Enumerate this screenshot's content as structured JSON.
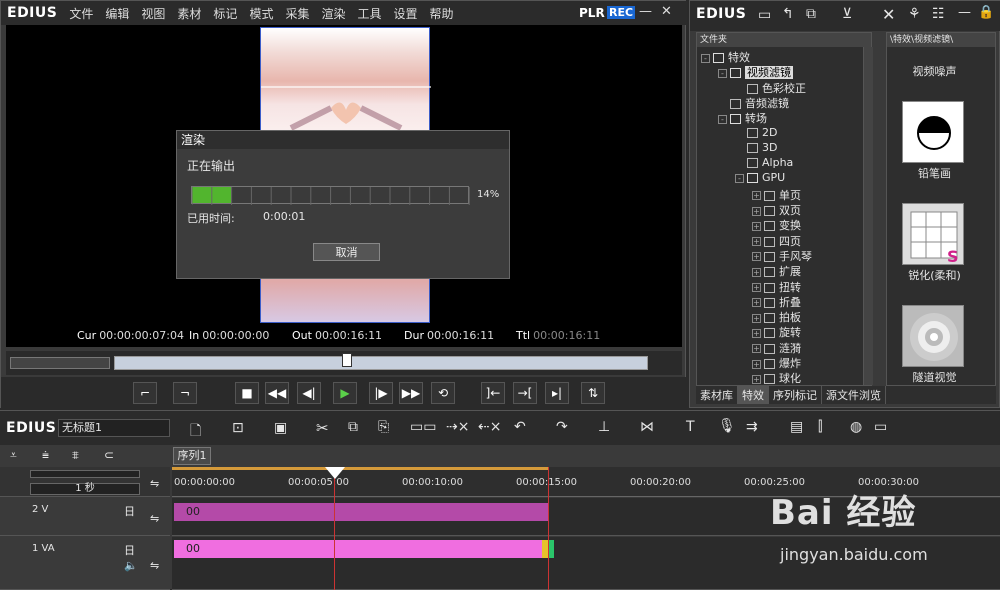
{
  "player": {
    "logo": "EDIUS",
    "menu": [
      "文件",
      "编辑",
      "视图",
      "素材",
      "标记",
      "模式",
      "采集",
      "渲染",
      "工具",
      "设置",
      "帮助"
    ],
    "plr": "PLR",
    "rec": "REC",
    "timecodes": [
      {
        "label": "Cur",
        "value": "00:00:00:07:04"
      },
      {
        "label": "In",
        "value": "00:00:00:00"
      },
      {
        "label": "Out",
        "value": "00:00:16:11"
      },
      {
        "label": "Dur",
        "value": "00:00:16:11"
      },
      {
        "label": "Ttl",
        "value": "00:00:16:11"
      }
    ]
  },
  "render_dialog": {
    "title": "渲染",
    "status": "正在输出",
    "progress": 14,
    "progress_label": "14%",
    "elapsed_label": "已用时间:",
    "elapsed_value": "0:00:01",
    "cancel": "取消"
  },
  "bin": {
    "logo": "EDIUS",
    "tree_header": "文件夹",
    "thumbs_header": "\\特效\\视频滤镜\\",
    "tree": [
      {
        "label": "特效",
        "level": 0,
        "exp": "-",
        "folder": true
      },
      {
        "label": "视频滤镜",
        "level": 1,
        "exp": "-",
        "folder": true,
        "selected": true
      },
      {
        "label": "色彩校正",
        "level": 2,
        "exp": "",
        "folder": false
      },
      {
        "label": "音频滤镜",
        "level": 1,
        "exp": "",
        "folder": false
      },
      {
        "label": "转场",
        "level": 1,
        "exp": "-",
        "folder": true
      },
      {
        "label": "2D",
        "level": 2,
        "exp": "",
        "folder": false
      },
      {
        "label": "3D",
        "level": 2,
        "exp": "",
        "folder": false
      },
      {
        "label": "Alpha",
        "level": 2,
        "exp": "",
        "folder": false
      },
      {
        "label": "GPU",
        "level": 2,
        "exp": "-",
        "folder": true
      },
      {
        "label": "单页",
        "level": 3,
        "exp": "+",
        "folder": false
      },
      {
        "label": "双页",
        "level": 3,
        "exp": "+",
        "folder": false
      },
      {
        "label": "变换",
        "level": 3,
        "exp": "+",
        "folder": false
      },
      {
        "label": "四页",
        "level": 3,
        "exp": "+",
        "folder": false
      },
      {
        "label": "手风琴",
        "level": 3,
        "exp": "+",
        "folder": false
      },
      {
        "label": "扩展",
        "level": 3,
        "exp": "+",
        "folder": false
      },
      {
        "label": "扭转",
        "level": 3,
        "exp": "+",
        "folder": false
      },
      {
        "label": "折叠",
        "level": 3,
        "exp": "+",
        "folder": false
      },
      {
        "label": "拍板",
        "level": 3,
        "exp": "+",
        "folder": false
      },
      {
        "label": "旋转",
        "level": 3,
        "exp": "+",
        "folder": false
      },
      {
        "label": "涟漪",
        "level": 3,
        "exp": "+",
        "folder": false
      },
      {
        "label": "爆炸",
        "level": 3,
        "exp": "+",
        "folder": false
      },
      {
        "label": "球化",
        "level": 3,
        "exp": "+",
        "folder": false
      }
    ],
    "thumbs": [
      "视频噪声",
      "铅笔画",
      "锐化(柔和)",
      "隧道视觉"
    ],
    "tabs": [
      "素材库",
      "特效",
      "序列标记",
      "源文件浏览"
    ]
  },
  "timeline": {
    "logo": "EDIUS",
    "project_title": "无标题1",
    "sequence_tab": "序列1",
    "scale": "1 秒",
    "ruler": [
      "00:00:00:00",
      "00:00:05:00",
      "00:00:10:00",
      "00:00:15:00",
      "00:00:20:00",
      "00:00:25:00",
      "00:00:30:00"
    ],
    "tracks": [
      {
        "name": "2 V",
        "clip": "00"
      },
      {
        "name": "1 VA",
        "clip": "00"
      }
    ]
  },
  "watermark": {
    "text": "Bai 经验",
    "url": "jingyan.baidu.com"
  },
  "colors": {
    "progress": "#52b52e",
    "clip_v": "#b44aa8",
    "clip_va": "#f06ee0",
    "playhead": "#cc3333"
  }
}
